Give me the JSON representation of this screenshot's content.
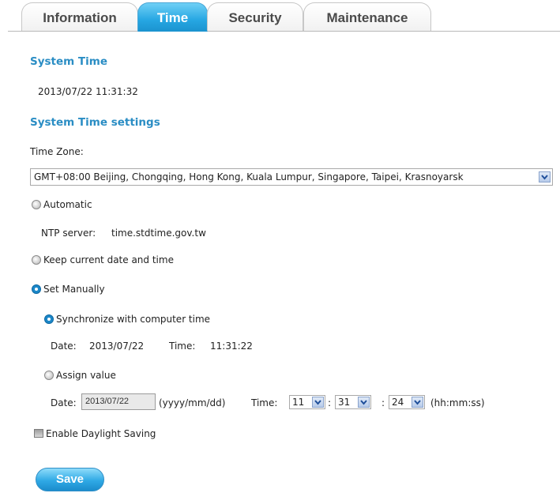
{
  "tabs": [
    {
      "label": "Information",
      "active": false
    },
    {
      "label": "Time",
      "active": true
    },
    {
      "label": "Security",
      "active": false
    },
    {
      "label": "Maintenance",
      "active": false
    }
  ],
  "system_time": {
    "heading": "System Time",
    "value": "2013/07/22 11:31:32"
  },
  "settings": {
    "heading": "System Time settings",
    "timezone_label": "Time Zone:",
    "timezone_value": "GMT+08:00 Beijing, Chongqing, Hong Kong, Kuala Lumpur, Singapore, Taipei, Krasnoyarsk",
    "automatic_label": "Automatic",
    "ntp_label": "NTP server:",
    "ntp_value": "time.stdtime.gov.tw",
    "keep_label": "Keep current date and time",
    "manual_label": "Set Manually",
    "sync_label": "Synchronize with computer time",
    "sync_date_label": "Date:",
    "sync_date_value": "2013/07/22",
    "sync_time_label": "Time:",
    "sync_time_value": "11:31:22",
    "assign_label": "Assign value",
    "assign_date_label": "Date:",
    "assign_date_value": "2013/07/22",
    "assign_date_hint": "(yyyy/mm/dd)",
    "assign_time_label": "Time:",
    "hour": "11",
    "minute": "31",
    "second": "24",
    "colon": ":",
    "time_hint": "(hh:mm:ss)",
    "daylight_label": "Enable Daylight Saving",
    "selected_mode": "Set Manually",
    "selected_manual_option": "Synchronize with computer time"
  },
  "buttons": {
    "save": "Save"
  },
  "colors": {
    "accent": "#2a8dc4",
    "tab_active": "#26a6e2",
    "radio_selected": "#1b87c8"
  },
  "icons": {
    "dropdown": "chevron-down-icon"
  }
}
